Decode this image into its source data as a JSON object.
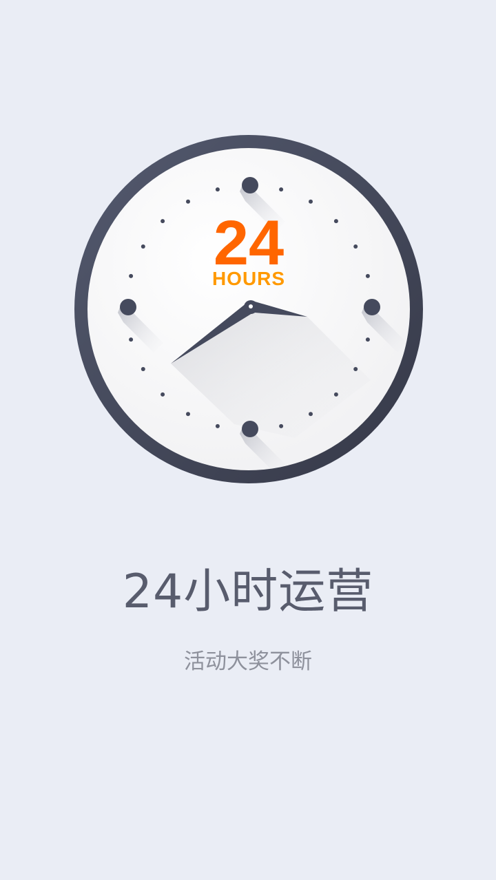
{
  "clock": {
    "number": "24",
    "unit": "HOURS",
    "colors": {
      "number": "#ff6600",
      "unit": "#ff9900",
      "rim": "#454a5d",
      "hands": "#454a5d",
      "face": "#fafafb"
    },
    "icon": "clock-icon"
  },
  "headline": "24小时运营",
  "subtitle": "活动大奖不断"
}
